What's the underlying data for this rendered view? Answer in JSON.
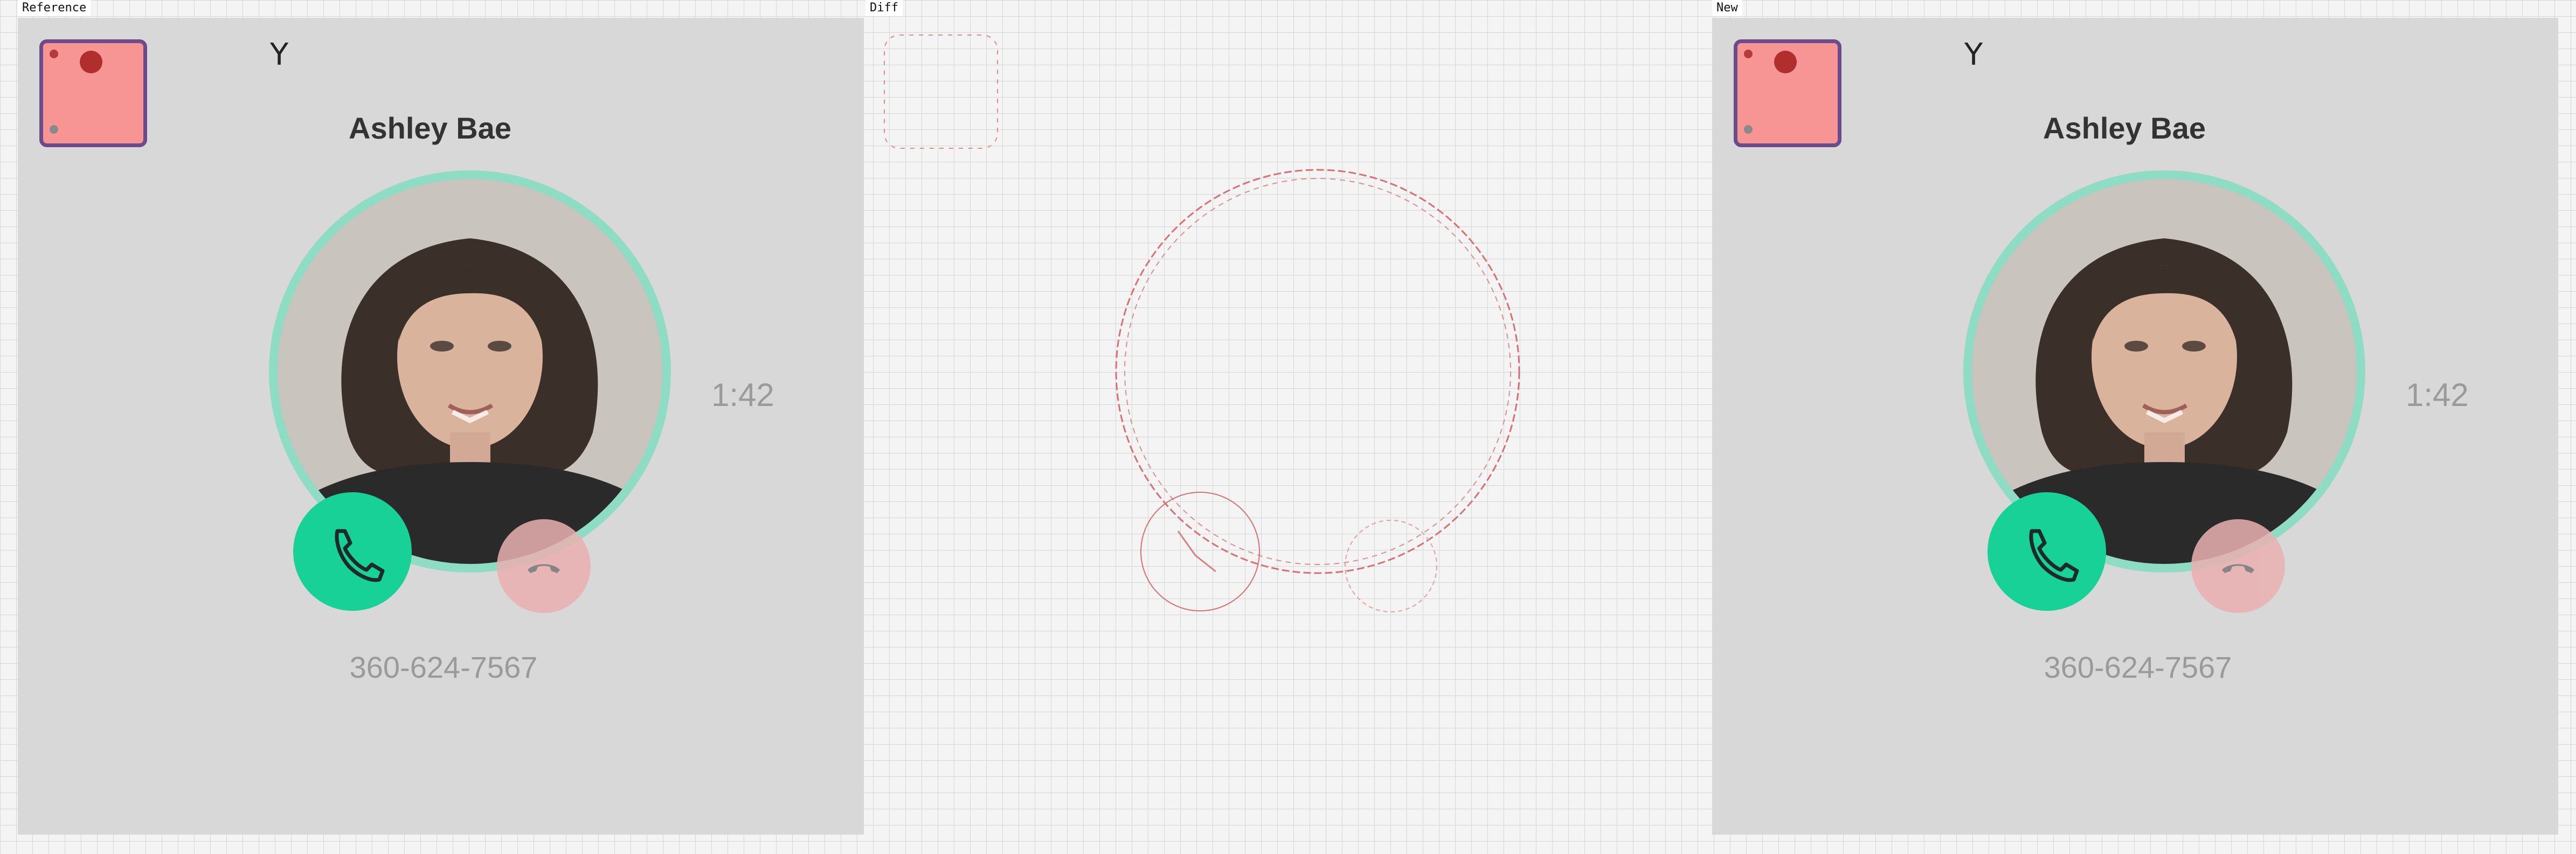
{
  "panel_labels": {
    "reference": "Reference",
    "diff": "Diff",
    "new": "New"
  },
  "call_screen": {
    "glyph": "Υ",
    "caller_name": "Ashley Bae",
    "call_timer": "1:42",
    "phone_number": "360-624-7567",
    "answer_icon": "phone-icon",
    "decline_icon": "hangup-icon",
    "avatar_placeholder_icon": "avatar-placeholder-icon",
    "colors": {
      "background": "#d8d8d8",
      "avatar_fill": "#f79494",
      "avatar_border": "#6b4b8a",
      "photo_ring": "#8fdcc5",
      "answer_button": "#17d196",
      "decline_button": "#eab0b0",
      "muted_text": "#9a9a9a",
      "name_text": "#333333"
    }
  }
}
